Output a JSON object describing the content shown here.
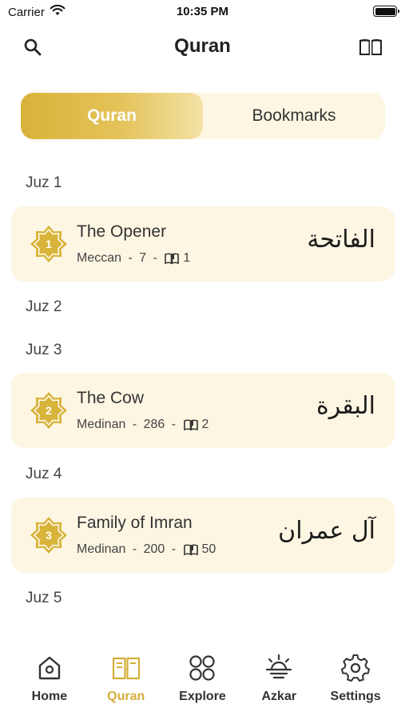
{
  "status_bar": {
    "carrier": "Carrier",
    "time": "10:35 PM"
  },
  "nav": {
    "title": "Quran",
    "left_icon": "search-icon",
    "right_icon": "book-icon"
  },
  "segment": {
    "tabs": [
      {
        "label": "Quran",
        "active": true
      },
      {
        "label": "Bookmarks",
        "active": false
      }
    ]
  },
  "list": {
    "juz_headers": [
      "Juz 1",
      "Juz 2",
      "Juz 3",
      "Juz 4",
      "Juz 5"
    ],
    "surahs": [
      {
        "number": "1",
        "name": "The Opener",
        "revelation": "Meccan",
        "verses": "7",
        "page": "1",
        "arabic": "الفاتحة"
      },
      {
        "number": "2",
        "name": "The Cow",
        "revelation": "Medinan",
        "verses": "286",
        "page": "2",
        "arabic": "البقرة"
      },
      {
        "number": "3",
        "name": "Family of Imran",
        "revelation": "Medinan",
        "verses": "200",
        "page": "50",
        "arabic": "آل عمران"
      }
    ],
    "separator": " - "
  },
  "tab_bar": {
    "items": [
      {
        "label": "Home",
        "icon": "home-icon",
        "active": false
      },
      {
        "label": "Quran",
        "icon": "quran-icon",
        "active": true
      },
      {
        "label": "Explore",
        "icon": "explore-icon",
        "active": false
      },
      {
        "label": "Azkar",
        "icon": "azkar-icon",
        "active": false
      },
      {
        "label": "Settings",
        "icon": "settings-icon",
        "active": false
      }
    ]
  },
  "colors": {
    "accent": "#d5ae3a",
    "card_bg": "#fdf6e3",
    "text": "#333333"
  }
}
